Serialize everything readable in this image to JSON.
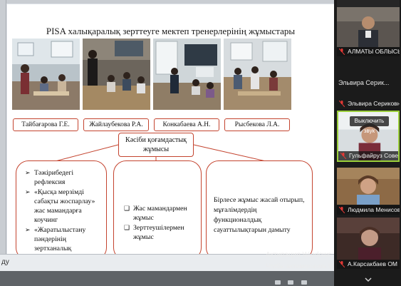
{
  "slide": {
    "title": "PISA халықаралық зерттеуге мектеп тренерлерінің жұмыстары",
    "names": [
      "Тайбағарова Г.Е.",
      "Жайлаубекова Р.А.",
      "Конкабаева А.Н.",
      "Рысбекова Л.А."
    ],
    "center_box": [
      "Кәсіби қоғамдастық",
      "жұмысы"
    ],
    "left_items": [
      "Тәжірибедегі рефлексия",
      "«Қысқа мерзімді сабақты жоспарлау» жас мамандарға коучинг",
      "«Жаратылыстану пәндерінің зертханалық сабақтарын STEM технологиясы арқылы"
    ],
    "middle_items": [
      "Жас мамандармен жұмыс",
      "Зерттеушілермен жұмыс"
    ],
    "right_text": "Бірлесе жұмыс жасай отырып, мұғалімдердің функционалдық сауаттылықтарын дамыту"
  },
  "bottom_bar": {
    "text": "ду"
  },
  "watermark": {
    "line1": "Активация Windows",
    "line2": "Чтобы активировать Windows, перейдите в"
  },
  "participants": [
    {
      "name": "АЛМАТЫ ОБЛЫСЫ...",
      "muted": true
    },
    {
      "name": "Эльвира Серик...",
      "muted": false
    },
    {
      "name": "Эльвира Сериковна",
      "muted": true
    },
    {
      "name": "Гульфайруз Советова ...",
      "muted": true,
      "action": "Выключить звук"
    },
    {
      "name": "Людмила Менисова",
      "muted": true
    },
    {
      "name": "А.Карсакбаев ОМ Қ...",
      "muted": true
    }
  ],
  "colors": {
    "accent": "#c4442f",
    "mute": "#e53935",
    "active_border": "#9bcf3a"
  }
}
